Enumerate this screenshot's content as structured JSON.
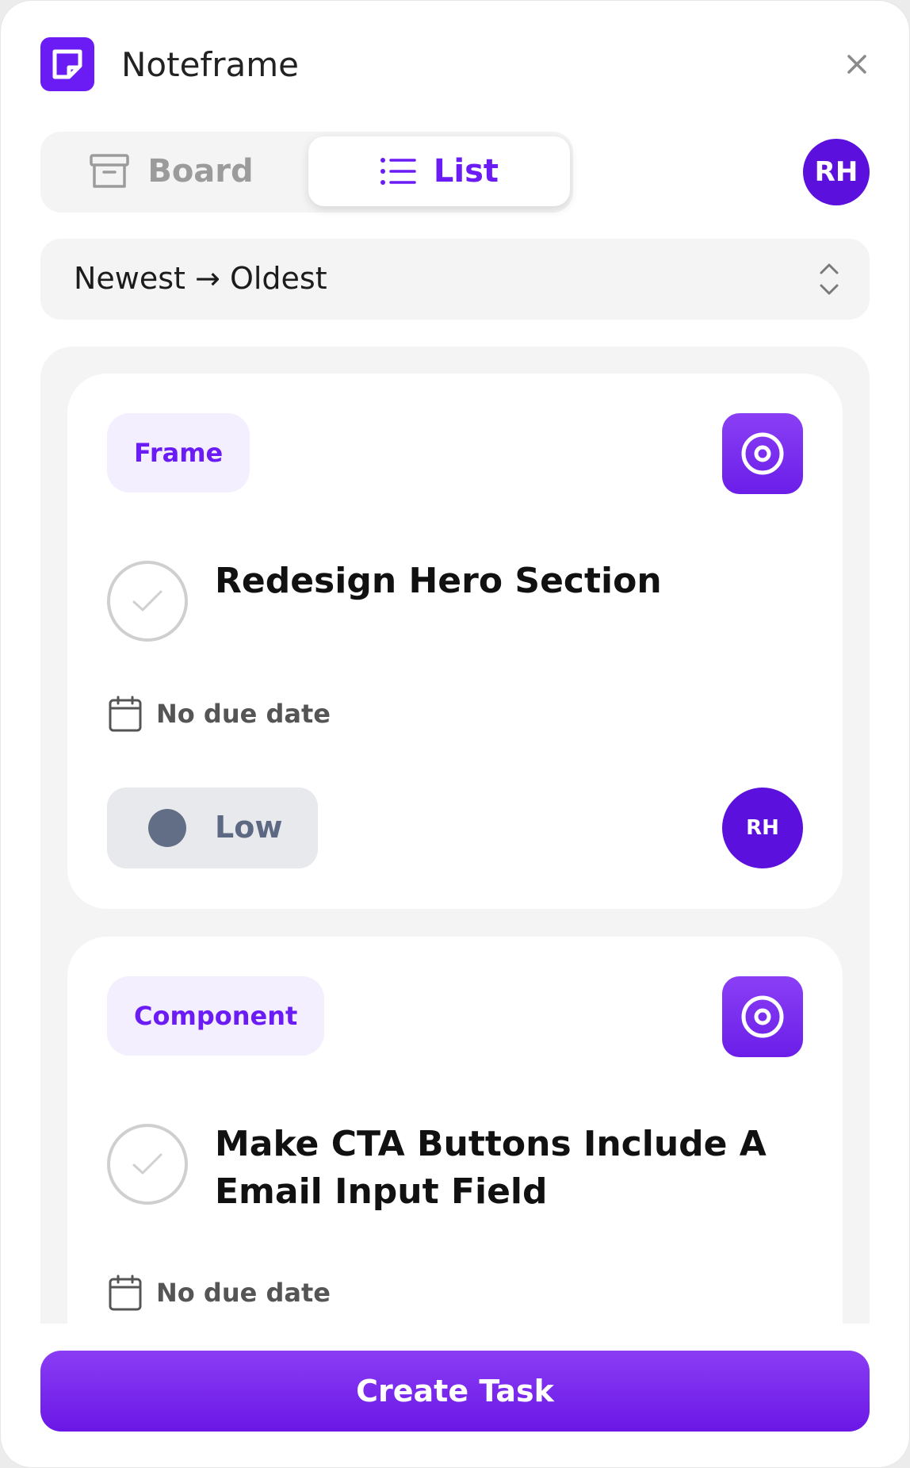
{
  "app": {
    "title": "Noteframe",
    "logo_icon": "noteframe-logo-icon",
    "close_icon": "close-icon"
  },
  "view_switch": {
    "tabs": [
      {
        "label": "Board",
        "icon": "archive-box-icon",
        "active": false
      },
      {
        "label": "List",
        "icon": "list-icon",
        "active": true
      }
    ]
  },
  "user": {
    "initials": "RH"
  },
  "sort": {
    "selected": "Newest → Oldest",
    "icon": "chevron-up-down-icon"
  },
  "tasks": [
    {
      "tag": "Frame",
      "title": "Redesign Hero Section",
      "completed": false,
      "due": "No due date",
      "priority": "Low",
      "assignee": "RH"
    },
    {
      "tag": "Component",
      "title": "Make CTA Buttons Include A Email Input Field",
      "completed": false,
      "due": "No due date"
    }
  ],
  "actions": {
    "create_label": "Create Task"
  },
  "colors": {
    "accent": "#6b1cf5",
    "avatar": "#5b10dd",
    "tag_bg": "#f3efff",
    "panel_bg": "#f4f4f4",
    "priority_low": "#626e86"
  }
}
